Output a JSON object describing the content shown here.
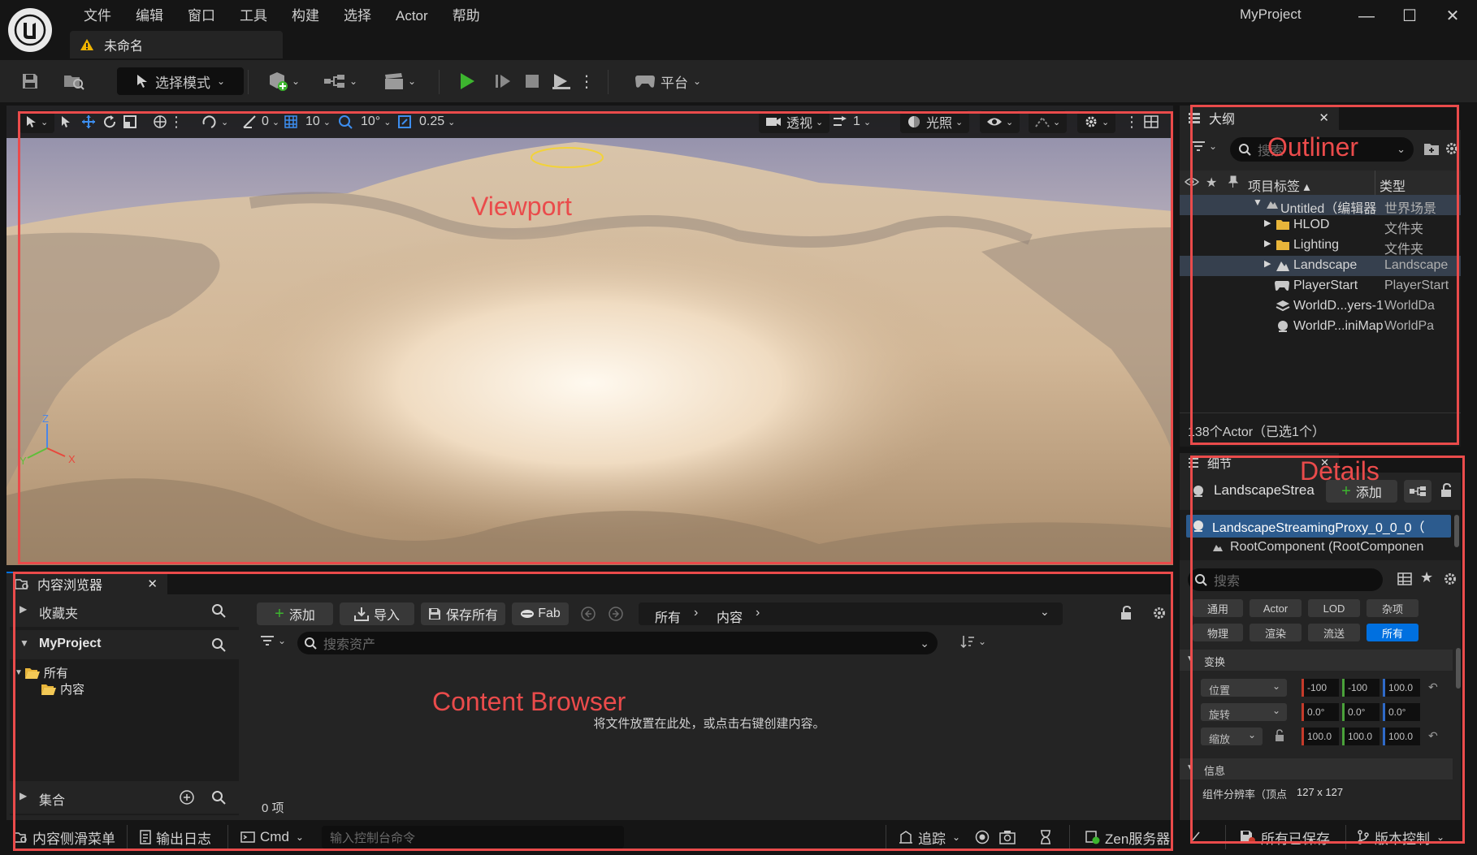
{
  "app": {
    "project_name": "MyProject",
    "document_tab": "未命名"
  },
  "menu": [
    "文件",
    "编辑",
    "窗口",
    "工具",
    "构建",
    "选择",
    "Actor",
    "帮助"
  ],
  "toolbar": {
    "select_mode": "选择模式",
    "platform": "平台"
  },
  "viewport": {
    "toolbar": {
      "angle_snap": "0",
      "grid_snap": "10",
      "rotation_snap": "10°",
      "scale_snap": "0.25",
      "view_mode": "透视",
      "camera_speed": "1",
      "lighting": "光照"
    },
    "axis_labels": {
      "x": "X",
      "y": "Y",
      "z": "Z"
    }
  },
  "outliner": {
    "title": "大纲",
    "search_placeholder": "搜索",
    "col_label": "项目标签",
    "col_type": "类型",
    "rows": [
      {
        "label": "Untitled（编辑器",
        "type": "世界场景"
      },
      {
        "label": "HLOD",
        "type": "文件夹"
      },
      {
        "label": "Lighting",
        "type": "文件夹"
      },
      {
        "label": "Landscape",
        "type": "Landscape"
      },
      {
        "label": "PlayerStart",
        "type": "PlayerStart"
      },
      {
        "label": "WorldD...yers-1",
        "type": "WorldDa"
      },
      {
        "label": "WorldP...iniMap",
        "type": "WorldPa"
      }
    ],
    "status": "138个Actor（已选1个）"
  },
  "details": {
    "title": "细节",
    "actor_name": "LandscapeStrea",
    "add_label": "添加",
    "component_selected": "LandscapeStreamingProxy_0_0_0（",
    "component_root": "RootComponent (RootComponen",
    "search_placeholder": "搜索",
    "filters_row1": [
      "通用",
      "Actor",
      "LOD",
      "杂项"
    ],
    "filters_row2": [
      "物理",
      "渲染",
      "流送",
      "所有"
    ],
    "transform_header": "变换",
    "location_label": "位置",
    "location": [
      "-100",
      "-100",
      "100.0"
    ],
    "rotation_label": "旋转",
    "rotation": [
      "0.0°",
      "0.0°",
      "0.0°"
    ],
    "scale_label": "缩放",
    "scale": [
      "100.0",
      "100.0",
      "100.0"
    ],
    "info_header": "信息",
    "info_row_label": "组件分辨率（顶点",
    "info_row_value": "127 x 127"
  },
  "content_browser": {
    "tab_title": "内容浏览器",
    "favorites": "收藏夹",
    "project": "MyProject",
    "tree_all": "所有",
    "tree_content": "内容",
    "collections": "集合",
    "add": "添加",
    "import": "导入",
    "save_all": "保存所有",
    "fab": "Fab",
    "breadcrumb_all": "所有",
    "breadcrumb_content": "内容",
    "search_placeholder": "搜索资产",
    "empty_hint": "将文件放置在此处，或点击右键创建内容。",
    "item_count": "0 项"
  },
  "statusbar": {
    "content_drawer": "内容侧滑菜单",
    "output_log": "输出日志",
    "cmd": "Cmd",
    "console_placeholder": "输入控制台命令",
    "trace": "追踪",
    "zen_server": "Zen服务器",
    "all_saved": "所有已保存",
    "source_control": "版本控制"
  },
  "annotations": {
    "outliner": "Outliner",
    "viewport": "Viewport",
    "details": "Details",
    "content_browser": "Content Browser"
  },
  "colors": {
    "annotation": "#ea4b4b",
    "accent_blue": "#0070e0",
    "play_green": "#3db52f",
    "selected_row": "#36404e"
  }
}
